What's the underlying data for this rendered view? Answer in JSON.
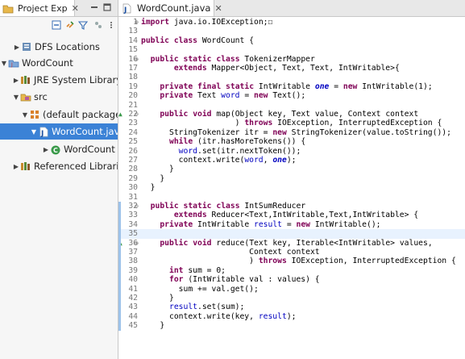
{
  "project_explorer": {
    "tab_label": "Project Exp",
    "tree": [
      {
        "label": "DFS Locations",
        "icon": "dfs-locations-icon",
        "expanded": null
      },
      {
        "label": "WordCount",
        "icon": "java-project-icon",
        "expanded": true
      },
      {
        "label": "JRE System Library [",
        "icon": "library-icon",
        "expanded": false
      },
      {
        "label": "src",
        "icon": "source-folder-icon",
        "expanded": true
      },
      {
        "label": "(default package)",
        "icon": "package-icon",
        "expanded": true
      },
      {
        "label": "WordCount.jav",
        "icon": "java-file-icon",
        "expanded": true,
        "selected": true
      },
      {
        "label": "WordCount",
        "icon": "class-icon",
        "expanded": false
      },
      {
        "label": "Referenced Libraries",
        "icon": "library-icon",
        "expanded": false
      }
    ]
  },
  "editor": {
    "tab_label": "WordCount.java",
    "lines": [
      {
        "n": "1",
        "fold": "⊕",
        "code": "import java.io.IOException;☐"
      },
      {
        "n": "13",
        "code": ""
      },
      {
        "n": "14",
        "code": "public class WordCount {"
      },
      {
        "n": "15",
        "code": ""
      },
      {
        "n": "16",
        "fold": "⊖",
        "code": "  public static class TokenizerMapper"
      },
      {
        "n": "17",
        "code": "       extends Mapper<Object, Text, Text, IntWritable>{"
      },
      {
        "n": "18",
        "code": ""
      },
      {
        "n": "19",
        "code": "    private final static IntWritable one = new IntWritable(1);"
      },
      {
        "n": "20",
        "code": "    private Text word = new Text();"
      },
      {
        "n": "21",
        "code": ""
      },
      {
        "n": "22",
        "fold": "⊖",
        "mark": "▲",
        "code": "    public void map(Object key, Text value, Context context"
      },
      {
        "n": "23",
        "code": "                    ) throws IOException, InterruptedException {"
      },
      {
        "n": "24",
        "code": "      StringTokenizer itr = new StringTokenizer(value.toString());"
      },
      {
        "n": "25",
        "code": "      while (itr.hasMoreTokens()) {"
      },
      {
        "n": "26",
        "code": "        word.set(itr.nextToken());"
      },
      {
        "n": "27",
        "code": "        context.write(word, one);"
      },
      {
        "n": "28",
        "code": "      }"
      },
      {
        "n": "29",
        "code": "    }"
      },
      {
        "n": "30",
        "code": "  }"
      },
      {
        "n": "31",
        "code": ""
      },
      {
        "n": "32",
        "fold": "⊖",
        "code": "  public static class IntSumReducer"
      },
      {
        "n": "33",
        "code": "       extends Reducer<Text,IntWritable,Text,IntWritable> {"
      },
      {
        "n": "34",
        "code": "    private IntWritable result = new IntWritable();"
      },
      {
        "n": "35",
        "code": "",
        "current": true
      },
      {
        "n": "36",
        "fold": "⊖",
        "mark": "▲",
        "code": "    public void reduce(Text key, Iterable<IntWritable> values,"
      },
      {
        "n": "37",
        "code": "                       Context context"
      },
      {
        "n": "38",
        "code": "                       ) throws IOException, InterruptedException {"
      },
      {
        "n": "39",
        "code": "      int sum = 0;"
      },
      {
        "n": "40",
        "code": "      for (IntWritable val : values) {"
      },
      {
        "n": "41",
        "code": "        sum += val.get();"
      },
      {
        "n": "42",
        "code": "      }"
      },
      {
        "n": "43",
        "code": "      result.set(sum);"
      },
      {
        "n": "44",
        "code": "      context.write(key, result);"
      },
      {
        "n": "45",
        "code": "    }"
      }
    ]
  }
}
